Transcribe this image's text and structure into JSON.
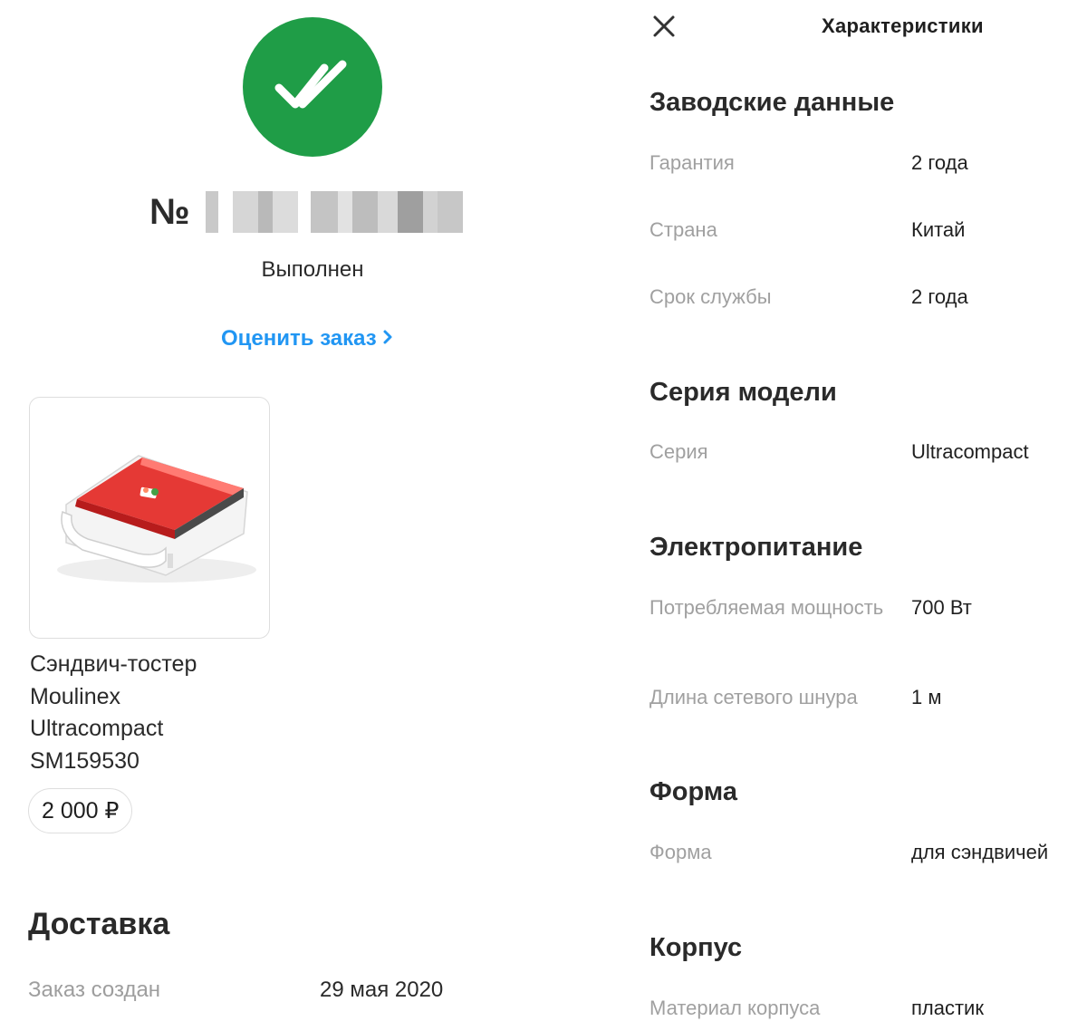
{
  "colors": {
    "success": "#1f9d47",
    "link": "#2196f3",
    "muted": "#9e9e9e",
    "text": "#1f1f1f"
  },
  "order": {
    "number_prefix": "№",
    "status": "Выполнен",
    "rate_link": "Оценить заказ",
    "product": {
      "name_lines": [
        "Сэндвич-тостер",
        "Moulinex",
        "Ultracompact",
        "SM159530"
      ],
      "price": "2 000 ₽"
    },
    "delivery": {
      "title": "Доставка",
      "created_label": "Заказ создан",
      "created_value": "29 мая 2020"
    }
  },
  "specs": {
    "header": "Характеристики",
    "sections": [
      {
        "title": "Заводские данные",
        "rows": [
          {
            "label": "Гарантия",
            "value": "2 года"
          },
          {
            "label": "Страна",
            "value": "Китай"
          },
          {
            "label": "Срок службы",
            "value": "2 года"
          }
        ]
      },
      {
        "title": "Серия модели",
        "rows": [
          {
            "label": "Серия",
            "value": "Ultracompact"
          }
        ]
      },
      {
        "title": "Электропитание",
        "rows": [
          {
            "label": "Потребляемая мощность",
            "value": "700 Вт"
          },
          {
            "label": "Длина сетевого шнура",
            "value": "1 м"
          }
        ]
      },
      {
        "title": "Форма",
        "rows": [
          {
            "label": "Форма",
            "value": "для сэндвичей"
          }
        ]
      },
      {
        "title": "Корпус",
        "rows": [
          {
            "label": "Материал корпуса",
            "value": "пластик"
          }
        ]
      }
    ]
  }
}
